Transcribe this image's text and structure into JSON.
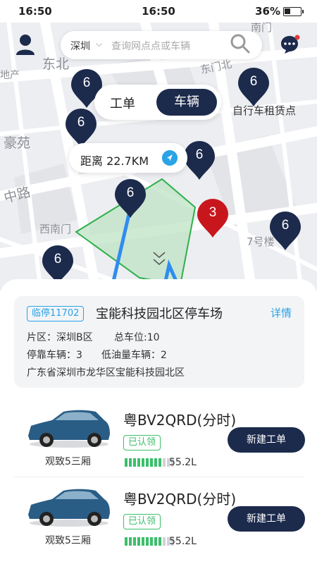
{
  "status_bar": {
    "time_left": "16:50",
    "time_center": "16:50",
    "battery": "36%"
  },
  "search": {
    "city": "深圳",
    "placeholder": "查询网点点或车辆"
  },
  "map": {
    "labels": [
      "东北",
      "地产",
      "豪苑",
      "中路",
      "西南门",
      "南门",
      "自行车租赁点",
      "7号楼",
      "东门北"
    ],
    "pins": [
      {
        "count": "6",
        "color": "#1c2a4c"
      },
      {
        "count": "6",
        "color": "#1c2a4c"
      },
      {
        "count": "6",
        "color": "#1c2a4c"
      },
      {
        "count": "6",
        "color": "#1c2a4c"
      },
      {
        "count": "6",
        "color": "#1c2a4c"
      },
      {
        "count": "6",
        "color": "#1c2a4c"
      },
      {
        "count": "6",
        "color": "#1c2a4c"
      },
      {
        "count": "3",
        "color": "#c8161d"
      }
    ],
    "toggle": {
      "option1": "工单",
      "option2": "车辆"
    },
    "distance": "距离  22.7KM"
  },
  "parking": {
    "tag": "临停11702",
    "name": "宝能科技园北区停车场",
    "details_link": "详情",
    "area": "片区：深圳B区",
    "total_spaces": "总车位:10",
    "parked": "停靠车辆：3",
    "low_fuel": "低油量车辆：2",
    "address": "广东省深圳市龙华区宝能科技园北区"
  },
  "vehicles": [
    {
      "model": "观致5三厢",
      "plate": "粤BV2QRD(分时)",
      "status": "已认领",
      "fuel": "55.2L",
      "fuel_level": 0.75,
      "action": "新建工单"
    },
    {
      "model": "观致5三厢",
      "plate": "粤BV2QRD(分时)",
      "status": "已认领",
      "fuel": "55.2L",
      "fuel_level": 0.75,
      "action": "新建工单"
    }
  ],
  "colors": {
    "primary": "#1c2a4c",
    "accent_blue": "#2aa3e6",
    "green": "#3cbf6b",
    "red_pin": "#c8161d"
  }
}
